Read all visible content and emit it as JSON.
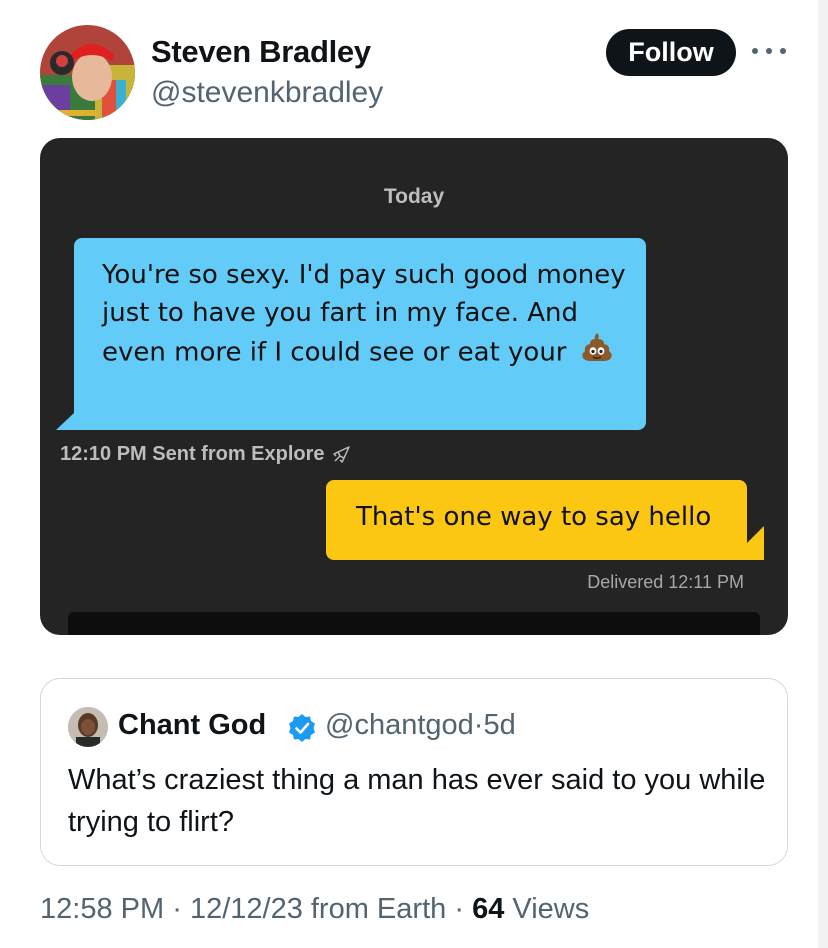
{
  "author": {
    "name": "Steven Bradley",
    "handle": "@stevenkbradley",
    "follow_label": "Follow"
  },
  "chat": {
    "day_label": "Today",
    "incoming": {
      "text": "You're so sexy. I'd pay such good money just to have you fart in my face. And even more if I could see or eat your",
      "emoji": "pile-of-poo-icon",
      "meta": "12:10 PM Sent from Explore"
    },
    "outgoing": {
      "text": "That's one way to say hello",
      "meta": "Delivered 12:11 PM"
    },
    "colors": {
      "background": "#242424",
      "incoming_bubble": "#63cbf8",
      "outgoing_bubble": "#fbc713"
    }
  },
  "quoted_tweet": {
    "name": "Chant God",
    "handle": "@chantgod",
    "separator": "·",
    "age": "5d",
    "text": "What’s craziest thing a man has ever said to you while trying to flirt?"
  },
  "footer": {
    "time": "12:58 PM",
    "date": "12/12/23 from Earth",
    "views_count": "64",
    "views_label": "Views",
    "separator": "·"
  },
  "colors": {
    "follow_button": "#0f1419",
    "verified_badge": "#1d9bf0",
    "secondary_text": "#536471"
  }
}
